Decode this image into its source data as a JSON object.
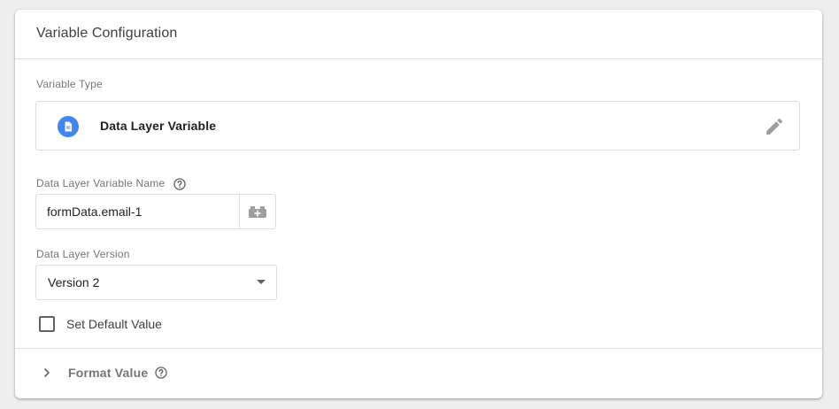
{
  "card": {
    "title": "Variable Configuration"
  },
  "variable_type": {
    "label": "Variable Type",
    "selected": "Data Layer Variable",
    "icon": "document-icon",
    "icon_color": "#4285f4"
  },
  "variable_name": {
    "label": "Data Layer Variable Name",
    "value": "formData.email-1",
    "help_icon": "help-circle-icon",
    "picker_icon": "variable-picker-icon"
  },
  "version": {
    "label": "Data Layer Version",
    "selected": "Version 2"
  },
  "default_value": {
    "label": "Set Default Value",
    "checked": false
  },
  "format_value": {
    "label": "Format Value",
    "expanded": false
  }
}
